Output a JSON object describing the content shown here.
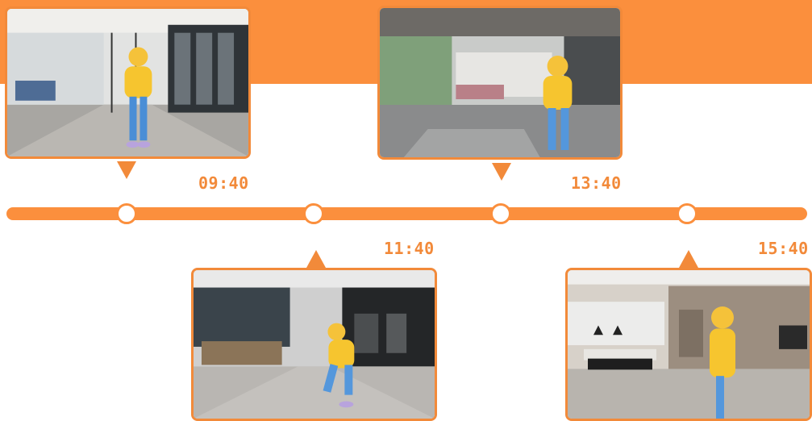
{
  "timeline": {
    "accent_color": "#fb8f3d",
    "events": [
      {
        "time": "09:40",
        "scene": "glass-office-corridor"
      },
      {
        "time": "11:40",
        "scene": "dark-lobby-hallway"
      },
      {
        "time": "13:40",
        "scene": "lounge-with-tables"
      },
      {
        "time": "15:40",
        "scene": "dining-room"
      }
    ]
  }
}
